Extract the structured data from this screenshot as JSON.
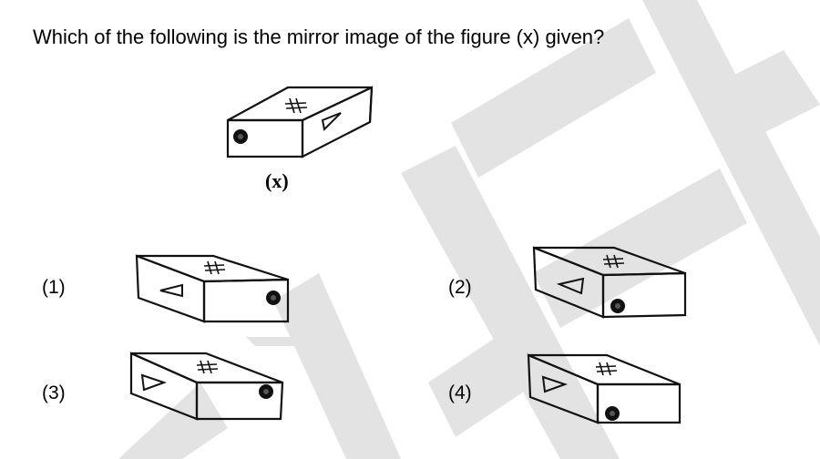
{
  "question": {
    "text": "Which of the following is the mirror image of the figure (x) given?"
  },
  "figure": {
    "label": "(x)",
    "top_symbol": "#",
    "front_symbol": "dot",
    "side_symbol": "triangle-right"
  },
  "options": [
    {
      "label": "(1)",
      "top_symbol": "#",
      "front_symbol": "triangle-left",
      "side_symbol": "dot"
    },
    {
      "label": "(2)",
      "top_symbol": "#",
      "front_symbol": "triangle-left",
      "side_symbol": "dot"
    },
    {
      "label": "(3)",
      "top_symbol": "#",
      "front_symbol": "triangle-right",
      "side_symbol": "dot"
    },
    {
      "label": "(4)",
      "top_symbol": "#",
      "front_symbol": "triangle-right",
      "side_symbol": "dot"
    }
  ],
  "colors": {
    "watermark": "#e3e3e3",
    "ink": "#111111"
  }
}
